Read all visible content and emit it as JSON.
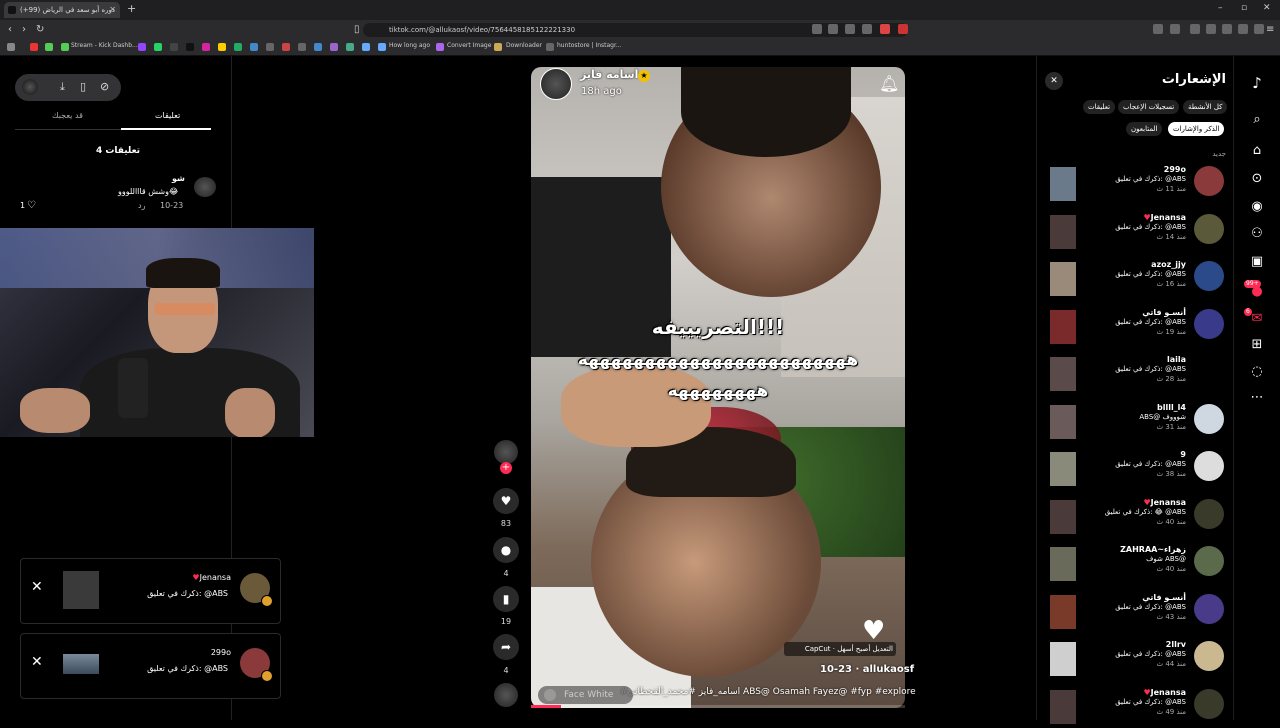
{
  "browser": {
    "tab_title": "دوره أبو سعد في الرياض (99+)",
    "url": "tiktok.com/@allukaosf/video/7564458185122221330",
    "bookmarks": [
      "Stream - Kick Dashb...",
      "How long ago",
      "Convert Image",
      "Downloader",
      "huntostore | Instagr..."
    ]
  },
  "left_panel": {
    "tabs": [
      "تعليقات",
      "قد يعجبك"
    ],
    "comments_count": "4 تعليقات",
    "comment": {
      "user": "شو",
      "text": "وشش قاااللووو😂",
      "date": "10-23",
      "reply": "رد",
      "likes": "1"
    }
  },
  "toasts": [
    {
      "name": "Jenansa",
      "message": "ذكرك في تعليق: @ABS"
    },
    {
      "name": "299o",
      "message": "ذكرك في تعليق: @ABS"
    }
  ],
  "video": {
    "author_display": "اسامه فايز",
    "posted": "18h ago",
    "overlay_line1": "التصريييفه!!!",
    "overlay_line2": "ههههههههههههههههههههههههه",
    "overlay_line3": "ههههههههه",
    "capcut": "CapCut · التعديل أصبح أسهل",
    "author_handle": "allukaosf",
    "date": "10-23",
    "caption": "#اسامه_فايز #محمد_القحطاني ABS@ Osamah Fayez@ #fyp #explore",
    "effect": "Face White"
  },
  "rail": {
    "likes": "83",
    "comments": "4",
    "saves": "19",
    "shares": "4"
  },
  "notifications": {
    "title": "الإشعارات",
    "filters": [
      "كل الأنشطة",
      "تسجيلات الإعجاب",
      "تعليقات",
      "الذكر والإشارات",
      "المتابعون"
    ],
    "section": "جديد",
    "items": [
      {
        "user": "299o",
        "message": "ذكرك في تعليق: @ABS",
        "time": "منذ 11 ث",
        "heart": false
      },
      {
        "user": "Jenansa",
        "message": "ذكرك في تعليق: @ABS",
        "time": "منذ 14 ث",
        "heart": true
      },
      {
        "user": "azoz_jjy",
        "message": "ذكرك في تعليق: @ABS",
        "time": "منذ 16 ث",
        "heart": false
      },
      {
        "user": "أنسـو فاتي",
        "message": "ذكرك في تعليق: @ABS",
        "time": "منذ 19 ث",
        "heart": false
      },
      {
        "user": "laila",
        "message": "ذكرك في تعليق: @ABS",
        "time": "منذ 28 ث",
        "heart": false
      },
      {
        "user": "bllll_l4",
        "message": "ABS@ شوووف",
        "time": "منذ 31 ث",
        "heart": false
      },
      {
        "user": "9",
        "message": "ذكرك في تعليق: @ABS",
        "time": "منذ 38 ث",
        "heart": false
      },
      {
        "user": "Jenansa",
        "message": "ذكرك في تعليق: 😂 @ABS",
        "time": "منذ 40 ث",
        "heart": true
      },
      {
        "user": "ZAHRAA~زهراء",
        "message": "شوف ABS@",
        "time": "منذ 40 ث",
        "heart": false
      },
      {
        "user": "أنسـو فاتي",
        "message": "ذكرك في تعليق: @ABS",
        "time": "منذ 43 ث",
        "heart": false
      },
      {
        "user": "2llrv",
        "message": "ذكرك في تعليق: @ABS",
        "time": "منذ 44 ث",
        "heart": false
      },
      {
        "user": "Jenansa",
        "message": "ذكرك في تعليق: @ABS",
        "time": "منذ 49 ث",
        "heart": true
      }
    ]
  },
  "right_nav": {
    "badge_notifications": "99+",
    "badge_messages": "6"
  },
  "colors": {
    "accent": "#fe2c55",
    "star": "#f2c000"
  }
}
